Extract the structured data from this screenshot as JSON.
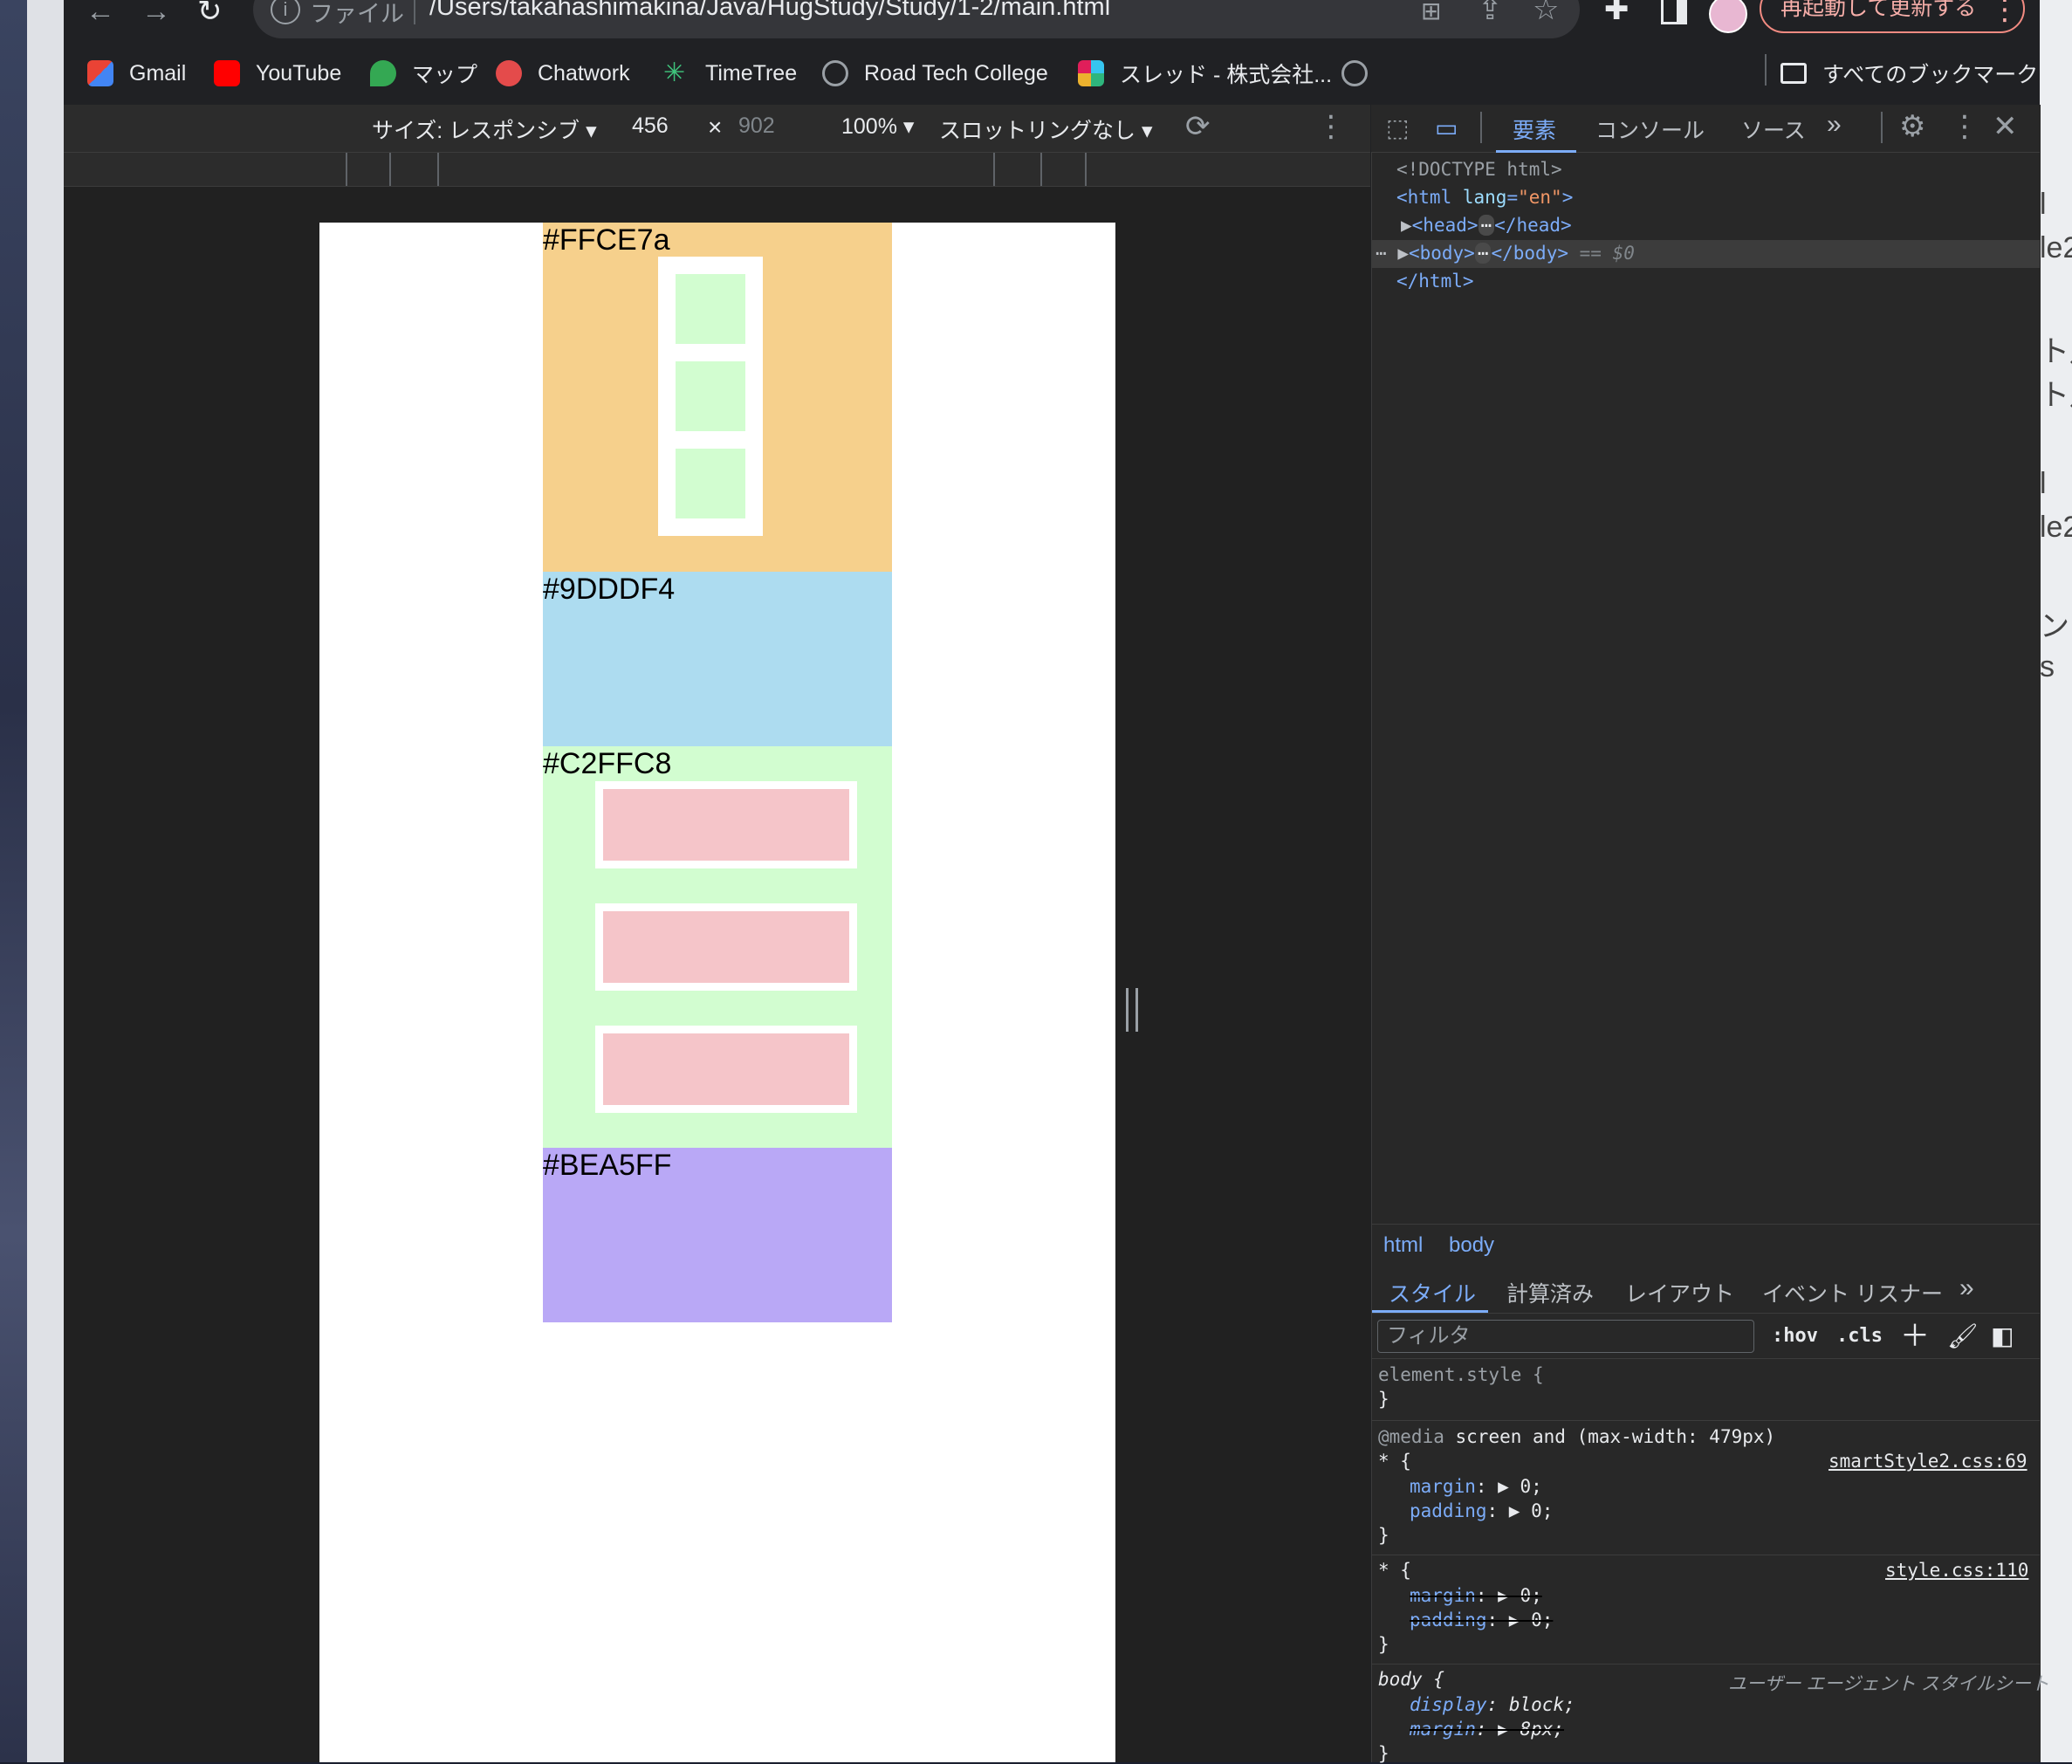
{
  "browser": {
    "omnibox_scheme": "ファイル",
    "url": "/Users/takahashimakina/Java/HugStudy/Study/1-2/main.html",
    "restart_button": "再起動して更新する"
  },
  "bookmarks": {
    "items": [
      "Gmail",
      "YouTube",
      "マップ",
      "Chatwork",
      "TimeTree",
      "Road Tech College",
      "スレッド - 株式会社..."
    ],
    "all_bookmarks": "すべてのブックマーク"
  },
  "device_toolbar": {
    "size_label": "サイズ: レスポンシブ ▾",
    "width": "456",
    "times": "×",
    "height": "902",
    "zoom": "100% ▾",
    "throttle": "スロットリングなし ▾"
  },
  "page": {
    "blocks": [
      {
        "label": "#FFCE7a",
        "color": "#F6D08C"
      },
      {
        "label": "#9DDDF4",
        "color": "#ADDCF0"
      },
      {
        "label": "#C2FFC8",
        "color": "#D2FDD0"
      },
      {
        "label": "#BEA5FF",
        "color": "#B9A8F6"
      }
    ]
  },
  "devtools": {
    "tabs": {
      "elements": "要素",
      "console": "コンソール",
      "sources": "ソース",
      "more": "»"
    },
    "dom": {
      "doctype": "<!DOCTYPE html>",
      "html_open_tag": "<html",
      "html_attr": "lang",
      "html_attr_value": "\"en\"",
      "head": "<head>",
      "head_close": "</head>",
      "body": "<body>",
      "body_close": "</body>",
      "selected_marker": "== $0",
      "html_close": "</html>"
    },
    "breadcrumb": [
      "html",
      "body"
    ],
    "styles_tabs": [
      "スタイル",
      "計算済み",
      "レイアウト",
      "イベント リスナー",
      "»"
    ],
    "filter_placeholder": "フィルタ",
    "hov": ":hov",
    ".cls": ".cls",
    "rules": {
      "element_style": "element.style {",
      "close": "}",
      "media_kw": "@media",
      "media_query": "screen and (max-width: 479px)",
      "star_open": "* {",
      "source1": "smartStyle2.css:69",
      "margin": "margin",
      "padding": "padding",
      "zero": "0;",
      "source2": "style.css:110",
      "body_open": "body {",
      "ua": "ユーザー エージェント スタイルシート",
      "display": "display",
      "block": "block;",
      "px8": "8px;"
    }
  }
}
